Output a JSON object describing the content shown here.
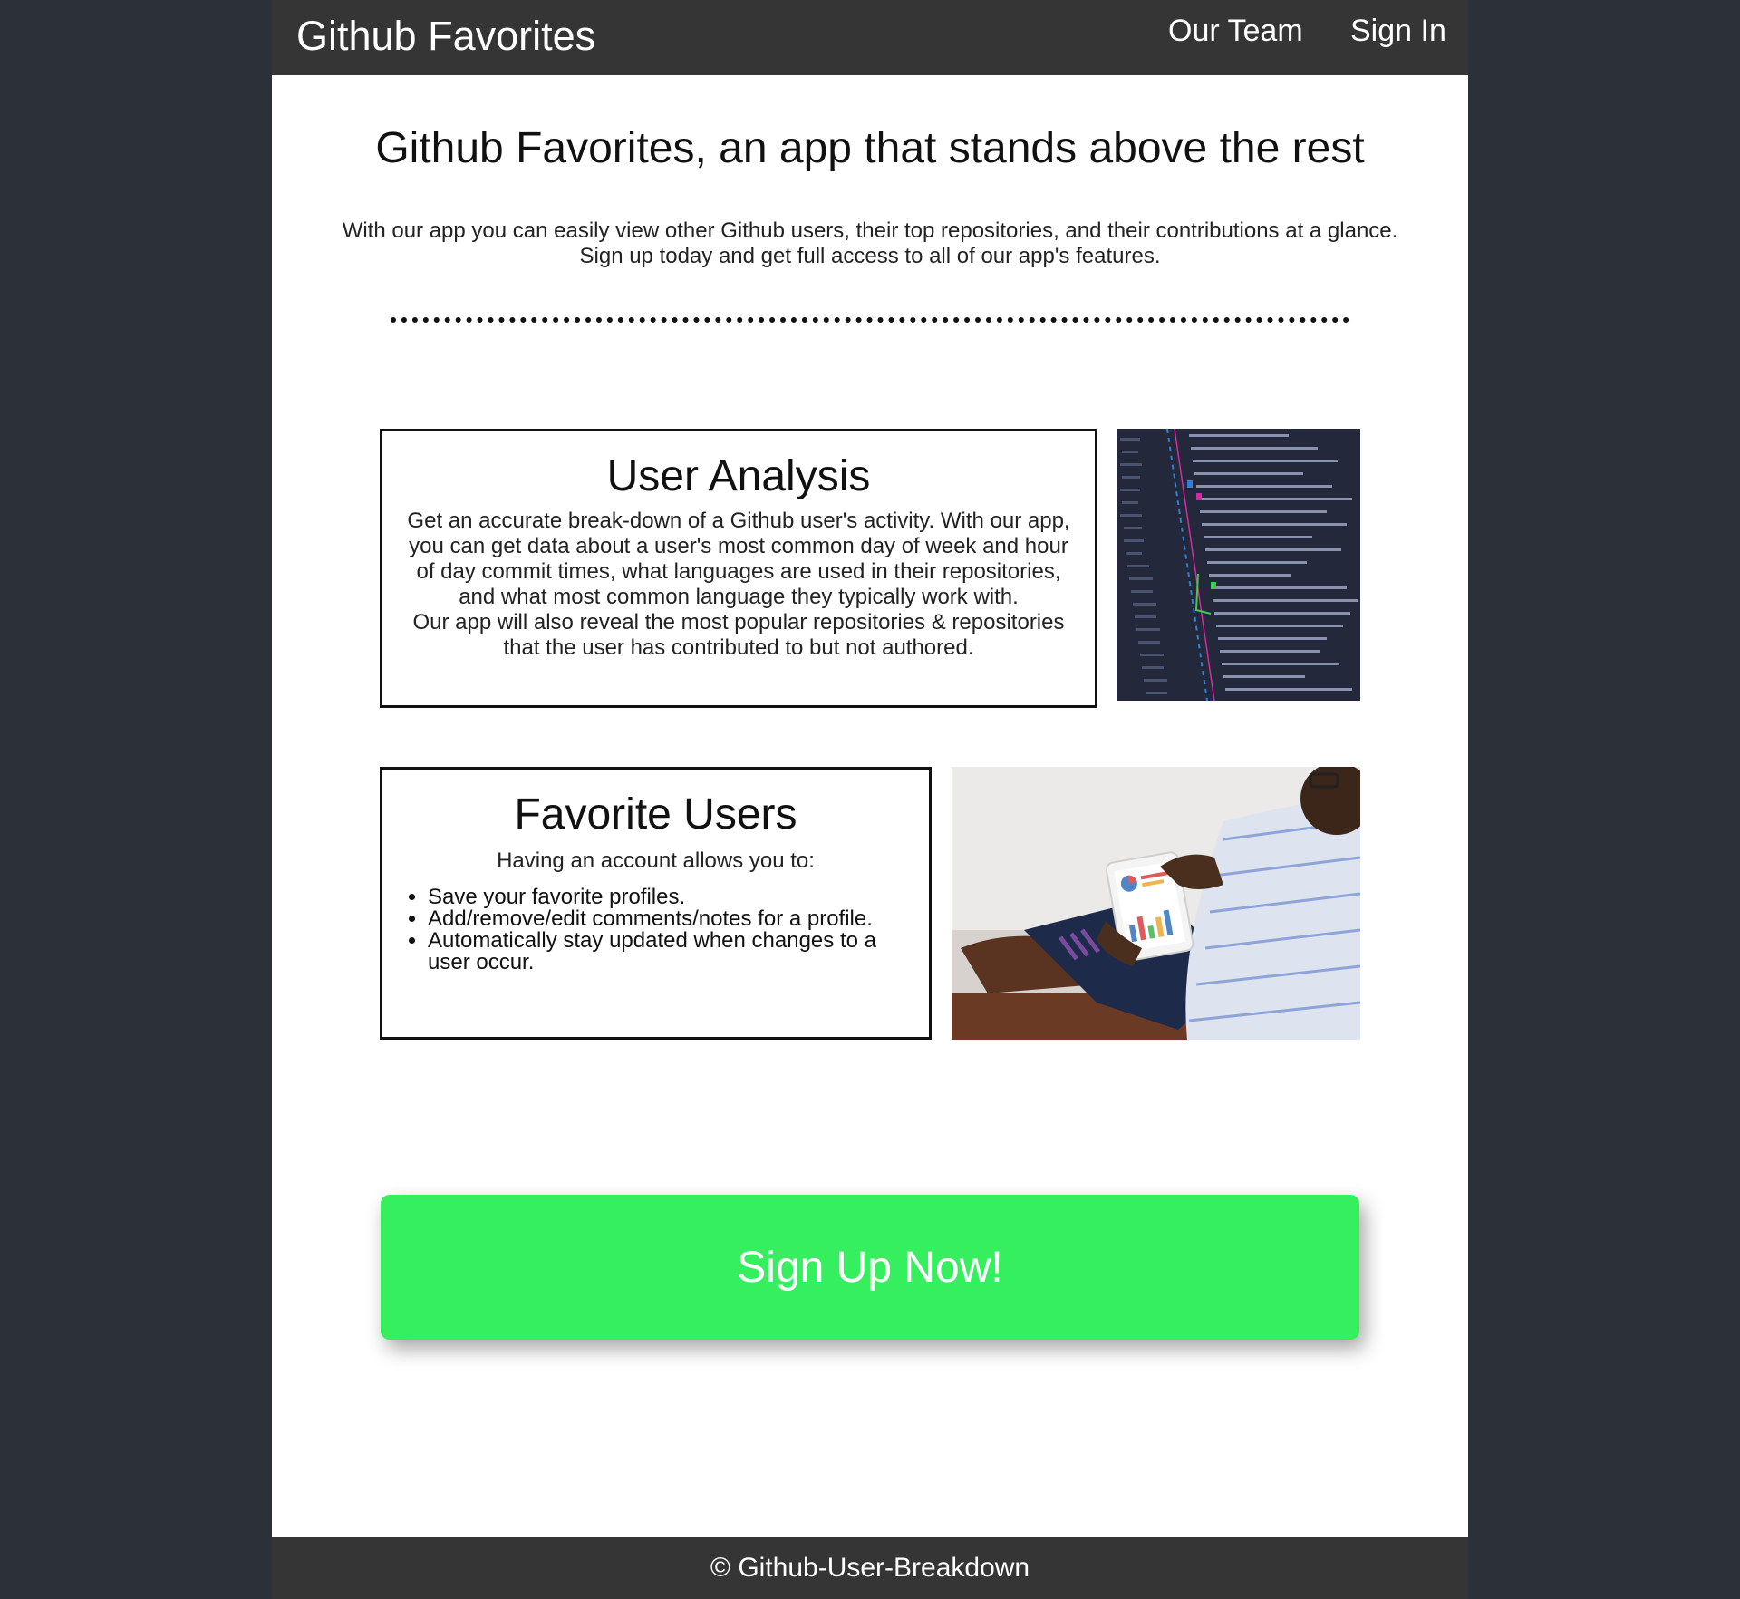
{
  "nav": {
    "brand": "Github Favorites",
    "links": [
      "Our Team",
      "Sign In"
    ]
  },
  "hero": {
    "title": "Github Favorites, an app that stands above the rest",
    "text_line1": "With our app you can easily view other Github users, their top repositories, and their contributions at a glance.",
    "text_line2": "Sign up today and get full access to all of our app's features."
  },
  "user_analysis": {
    "title": "User Analysis",
    "paragraph1": "Get an accurate break-down of a Github user's activity. With our app, you can get data about a user's most common day of week and hour of day commit times, what languages are used in their repositories, and what most common language they typically work with.",
    "paragraph2": "Our app will also reveal the most popular repositories & repositories that the user has contributed to but not authored."
  },
  "favorite_users": {
    "title": "Favorite Users",
    "intro": "Having an account allows you to:",
    "items": [
      "Save your favorite profiles.",
      "Add/remove/edit comments/notes for a profile.",
      "Automatically stay updated when changes to a user occur."
    ]
  },
  "cta": {
    "label": "Sign Up Now!",
    "color": "#36ef5e"
  },
  "footer": {
    "text": "© Github-User-Breakdown"
  },
  "colors": {
    "outer_background": "#2c3038",
    "navbar": "#353535",
    "page": "#ffffff"
  }
}
